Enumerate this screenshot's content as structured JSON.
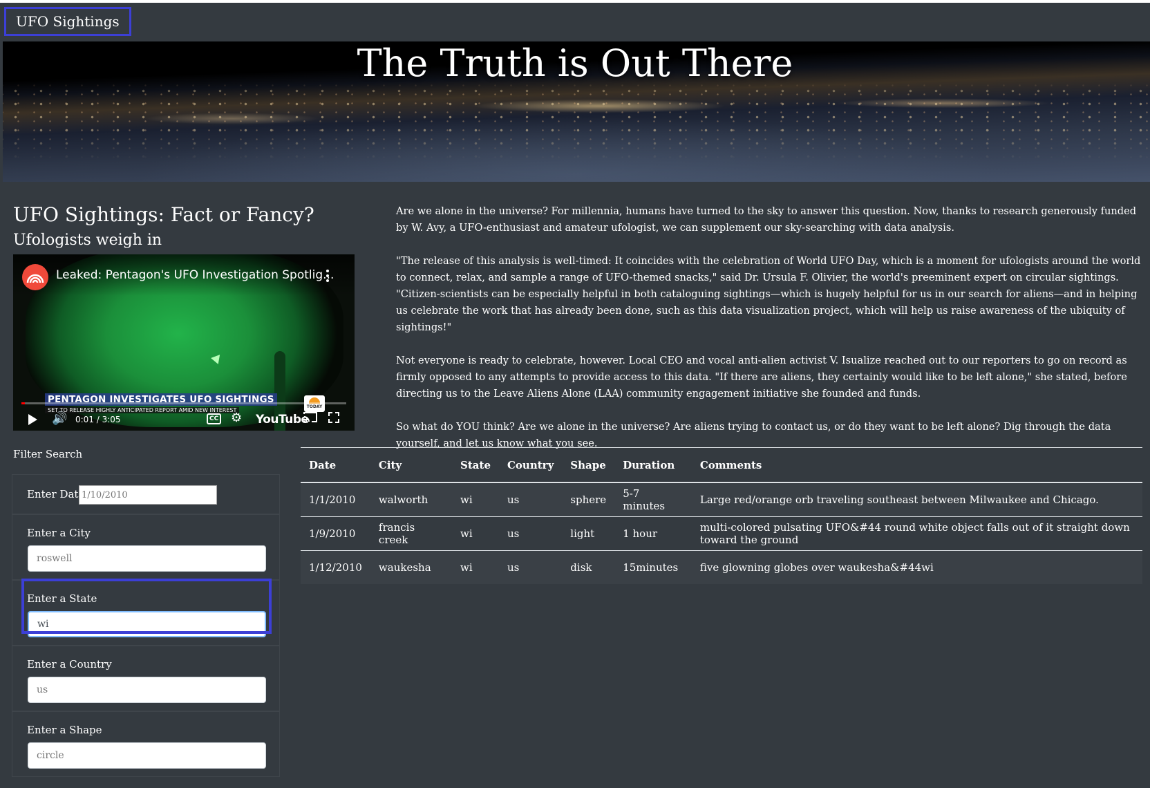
{
  "nav": {
    "brand": "UFO Sightings"
  },
  "hero": {
    "title": "The Truth is Out There"
  },
  "intro": {
    "title": "UFO Sightings: Fact or Fancy?",
    "subtitle": "Ufologists weigh in"
  },
  "video": {
    "title": "Leaked: Pentagon's UFO Investigation Spotlig...",
    "banner": "PENTAGON INVESTIGATES UFO SIGHTINGS",
    "banner_sub": "SET TO RELEASE HIGHLY ANTICIPATED REPORT AMID NEW INTEREST",
    "badge": "TODAY",
    "time": "0:01 / 3:05",
    "progress_fraction": 0.005,
    "cc_label": "CC",
    "platform": "YouTube"
  },
  "article": {
    "paragraphs": [
      "Are we alone in the universe? For millennia, humans have turned to the sky to answer this question. Now, thanks to research generously funded by W. Avy, a UFO-enthusiast and amateur ufologist, we can supplement our sky-searching with data analysis.",
      "\"The release of this analysis is well-timed: It coincides with the celebration of World UFO Day, which is a moment for ufologists around the world to connect, relax, and sample a range of UFO-themed snacks,\" said Dr. Ursula F. Olivier, the world's preeminent expert on circular sightings. \"Citizen-scientists can be especially helpful in both cataloguing sightings—which is hugely helpful for us in our search for aliens—and in helping us celebrate the work that has already been done, such as this data visualization project, which will help us raise awareness of the ubiquity of sightings!\"",
      "Not everyone is ready to celebrate, however. Local CEO and vocal anti-alien activist V. Isualize reached out to our reporters to go on record as firmly opposed to any attempts to provide access to this data. \"If there are aliens, they certainly would like to be left alone,\" she stated, before directing us to the Leave Aliens Alone (LAA) community engagement initiative she founded and funds.",
      "So what do YOU think? Are we alone in the universe? Are aliens trying to contact us, or do they want to be left alone? Dig through the data yourself, and let us know what you see."
    ]
  },
  "filters": {
    "heading": "Filter Search",
    "date": {
      "label": "Enter Date",
      "placeholder": "1/10/2010"
    },
    "city": {
      "label": "Enter a City",
      "placeholder": "roswell"
    },
    "state": {
      "label": "Enter a State",
      "value": "wi"
    },
    "country": {
      "label": "Enter a Country",
      "placeholder": "us"
    },
    "shape": {
      "label": "Enter a Shape",
      "placeholder": "circle"
    }
  },
  "table": {
    "headers": [
      "Date",
      "City",
      "State",
      "Country",
      "Shape",
      "Duration",
      "Comments"
    ],
    "rows": [
      [
        "1/1/2010",
        "walworth",
        "wi",
        "us",
        "sphere",
        "5-7 minutes",
        "Large red/orange orb traveling southeast between Milwaukee and Chicago."
      ],
      [
        "1/9/2010",
        "francis creek",
        "wi",
        "us",
        "light",
        "1 hour",
        "multi-colored pulsating UFO&#44 round white object falls out of it straight down toward the ground"
      ],
      [
        "1/12/2010",
        "waukesha",
        "wi",
        "us",
        "disk",
        "15minutes",
        "five glowning globes over waukesha&#44wi"
      ]
    ]
  },
  "colors": {
    "background": "#343a40",
    "highlight": "#3c3fd6",
    "channel_logo": "#f0493a"
  }
}
